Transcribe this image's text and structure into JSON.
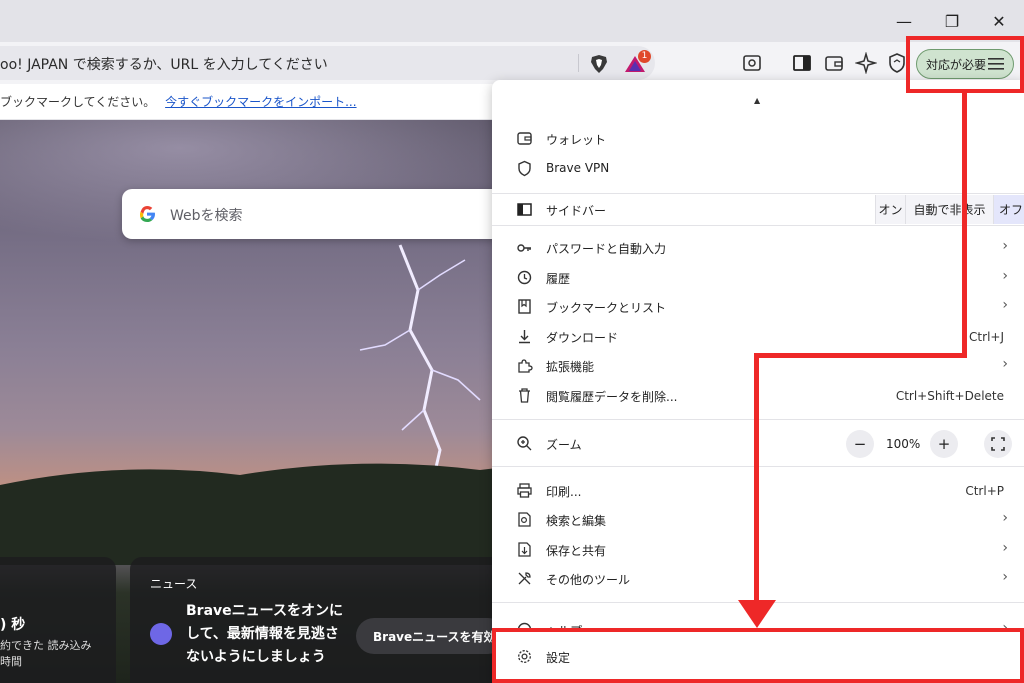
{
  "window": {
    "minimize_glyph": "—",
    "restore_glyph": "❐",
    "close_glyph": "✕"
  },
  "omnibox": {
    "text": "oo! JAPAN で検索するか、URL を入力してください",
    "shield_icon": "brave-shield-icon",
    "rewards_badge": "1"
  },
  "toolbar": {
    "update_button_label": "対応が必要",
    "icons": [
      "page-search-icon",
      "sidebar-icon",
      "wallet-icon",
      "leo-ai-icon",
      "vpn-icon",
      "menu-icon"
    ]
  },
  "bookmarks_bar": {
    "text": "ブックマークしてください。",
    "link": "今すぐブックマークをインポート..."
  },
  "ntp": {
    "search_placeholder": "Webを検索",
    "stats_value": ") 秒",
    "stats_line1": "約できた  読み込み",
    "stats_line2": "時間",
    "news_title": "ニュース",
    "news_body": "Braveニュースをオンにして、最新情報を見逃さないようにしましょう",
    "news_button": "Braveニュースを有効に"
  },
  "menu": {
    "caret": "▲",
    "items": {
      "wallet": "ウォレット",
      "vpn": "Brave VPN",
      "sidebar": "サイドバー",
      "sidebar_on": "オン",
      "sidebar_auto": "自動で非表示",
      "sidebar_off": "オフ",
      "passwords": "パスワードと自動入力",
      "history": "履歴",
      "bookmarks": "ブックマークとリスト",
      "downloads": "ダウンロード",
      "downloads_shortcut": "Ctrl+J",
      "extensions": "拡張機能",
      "clear_data": "閲覧履歴データを削除...",
      "clear_data_shortcut": "Ctrl+Shift+Delete",
      "zoom": "ズーム",
      "zoom_minus": "−",
      "zoom_value": "100%",
      "zoom_plus": "+",
      "print": "印刷...",
      "print_shortcut": "Ctrl+P",
      "search_edit": "検索と編集",
      "save_share": "保存と共有",
      "more_tools": "その他のツール",
      "help": "ヘルプ",
      "settings": "設定"
    },
    "arrow": "›"
  },
  "colors": {
    "highlight": "#ee2828",
    "update_button_bg": "#cfe3cf"
  }
}
